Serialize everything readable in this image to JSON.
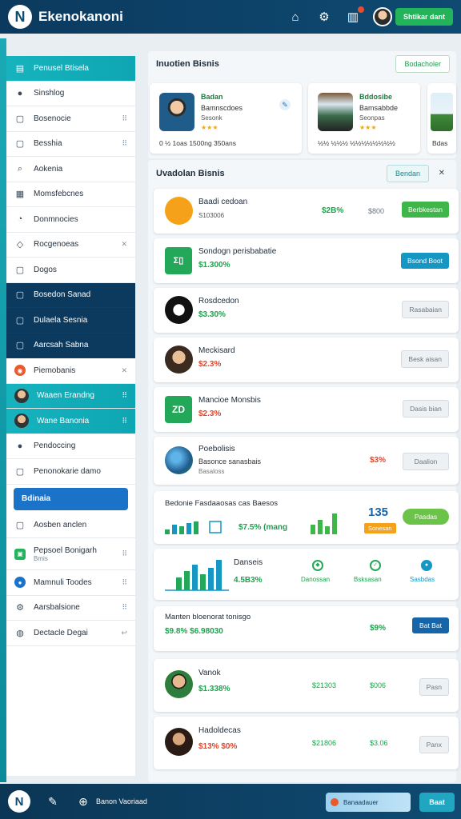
{
  "app": {
    "title": "Ekenokanoni",
    "logo_letter": "N"
  },
  "topbar": {
    "user_button": "Shtikar dant",
    "notification_color": "#e2502f"
  },
  "sidebar": {
    "items": [
      {
        "label": "Penusel Btisela",
        "icon": "book-icon",
        "style": "teal",
        "right": ""
      },
      {
        "label": "Sinshlog",
        "icon": "circle-icon",
        "style": "plain",
        "right": ""
      },
      {
        "label": "Bosenocie",
        "icon": "document-icon",
        "style": "plain",
        "right": "⠿"
      },
      {
        "label": "Besshia",
        "icon": "document-icon",
        "style": "plain",
        "right": "⠿"
      },
      {
        "label": "Aokenia",
        "icon": "search-icon",
        "style": "plain",
        "right": ""
      },
      {
        "label": "Momsfebcnes",
        "icon": "calendar-icon",
        "style": "plain",
        "right": ""
      },
      {
        "label": "Donmnocies",
        "icon": "speech-icon",
        "style": "plain",
        "right": ""
      },
      {
        "label": "Rocgenoeas",
        "icon": "tag-icon",
        "style": "plain",
        "right": "✕"
      },
      {
        "label": "Dogos",
        "icon": "document-icon",
        "style": "plain",
        "right": ""
      },
      {
        "label": "Bosedon Sanad",
        "icon": "document-icon",
        "style": "navy",
        "right": ""
      },
      {
        "label": "Dulaela Sesnia",
        "icon": "document-icon",
        "style": "navy",
        "right": ""
      },
      {
        "label": "Aarcsah Sabna",
        "icon": "document-icon",
        "style": "navy",
        "right": ""
      },
      {
        "label": "Piemobanis",
        "icon": "orange-badge-icon",
        "style": "plain",
        "right": "✕"
      },
      {
        "label": "Waaen Erandng",
        "icon": "avatar-icon",
        "style": "teal",
        "right": "⠿"
      },
      {
        "label": "Wane Banonia",
        "icon": "avatar-icon",
        "style": "teal",
        "right": "⠿"
      },
      {
        "label": "Pendoccing",
        "icon": "circle-icon",
        "style": "plain",
        "right": ""
      },
      {
        "label": "Penonokarie damo",
        "icon": "document-icon",
        "style": "plain",
        "right": ""
      },
      {
        "label": "Bdinaia",
        "icon": "",
        "style": "button",
        "right": ""
      },
      {
        "label": "Aosben anclen",
        "icon": "document-icon",
        "style": "plain",
        "right": ""
      },
      {
        "label": "Pepsoel Bonigarh",
        "sub": "Bmis",
        "icon": "green-badge-icon",
        "style": "plain",
        "right": "⠿"
      },
      {
        "label": "Mamnuli Toodes",
        "icon": "blue-badge-icon",
        "style": "plain",
        "right": "⠿"
      },
      {
        "label": "Aarsbalsione",
        "icon": "gear-icon",
        "style": "plain",
        "right": "⠿"
      },
      {
        "label": "Dectacle Degai",
        "icon": "globe-icon",
        "style": "plain",
        "right": "↩"
      }
    ]
  },
  "featured": {
    "title": "Inuotien Bisnis",
    "action": "Bodacholer",
    "cards": [
      {
        "name": "Badan",
        "sub": "Bamnscdoes",
        "sub2": "Sesonk",
        "stars": "★★★",
        "foot": "0 ½ 1oas   1500ng 350ans"
      },
      {
        "name": "Bddosibe",
        "sub": "Bamsabbde",
        "sub2": "Seonpas",
        "stars": "★★★",
        "foot": "½½ ½½½   ½½½½½½½½"
      },
      {
        "name": "",
        "sub": "",
        "sub2": "",
        "stars": "",
        "foot": "Bdas"
      }
    ]
  },
  "list_section": {
    "title": "Uvadolan Bisnis",
    "action": "Bendan",
    "close": "✕",
    "rows": [
      {
        "name": "Baadi cedoan",
        "sub": "S103006",
        "value": "$2B%",
        "value2": "$800",
        "button": "Berbkestan",
        "button_style": "green"
      },
      {
        "name": "Sondogn perisbabatie",
        "value": "$1.300%",
        "value2": "",
        "button": "Bsond Boot",
        "button_style": "teal"
      },
      {
        "name": "Rosdcedon",
        "value": "$3.30%",
        "value2": "",
        "button": "Rasabaian",
        "button_style": "grey"
      },
      {
        "name": "Meckisard",
        "value": "$2.3%",
        "value2": "",
        "button": "Besk aisan",
        "button_style": "grey"
      },
      {
        "name": "Mancioe Monsbis",
        "value": "$2.3%",
        "value2": "",
        "button": "Dasis bian",
        "button_style": "grey"
      },
      {
        "name": "Poebolisis",
        "sub": "Basonce sanasbais",
        "sub2": "Basaloss",
        "value": "$3%",
        "value2": "",
        "button": "Daalion",
        "button_style": "grey"
      }
    ],
    "stats_card": {
      "title": "Bedonie Fasdaaosas cas Baesos",
      "value": "$7.5% (mang",
      "big_number": "135",
      "big_label": "Sonesan",
      "button": "Pasdas"
    },
    "chart_card": {
      "title": "Danseis",
      "value": "4.5B3%",
      "icons": [
        "Danossan",
        "Bsksasan",
        "Sasbdas"
      ]
    },
    "summary_card": {
      "title": "Manten bloenorat tonisgo",
      "value": "$9.8% $6.98030",
      "value2": "$9%",
      "button": "Bat Bat"
    },
    "people": [
      {
        "name": "Vanok",
        "value": "$1.338%",
        "value2": "$21303",
        "value3": "$006",
        "button": "Pasn"
      },
      {
        "name": "Hadoldecas",
        "value": "$13% $0%",
        "value2": "$21806",
        "value3": "$3.06",
        "button": "Panx"
      }
    ]
  },
  "bottombar": {
    "label": "Banon Vaoriaad",
    "field": "Banaadauer",
    "button": "Baat"
  }
}
